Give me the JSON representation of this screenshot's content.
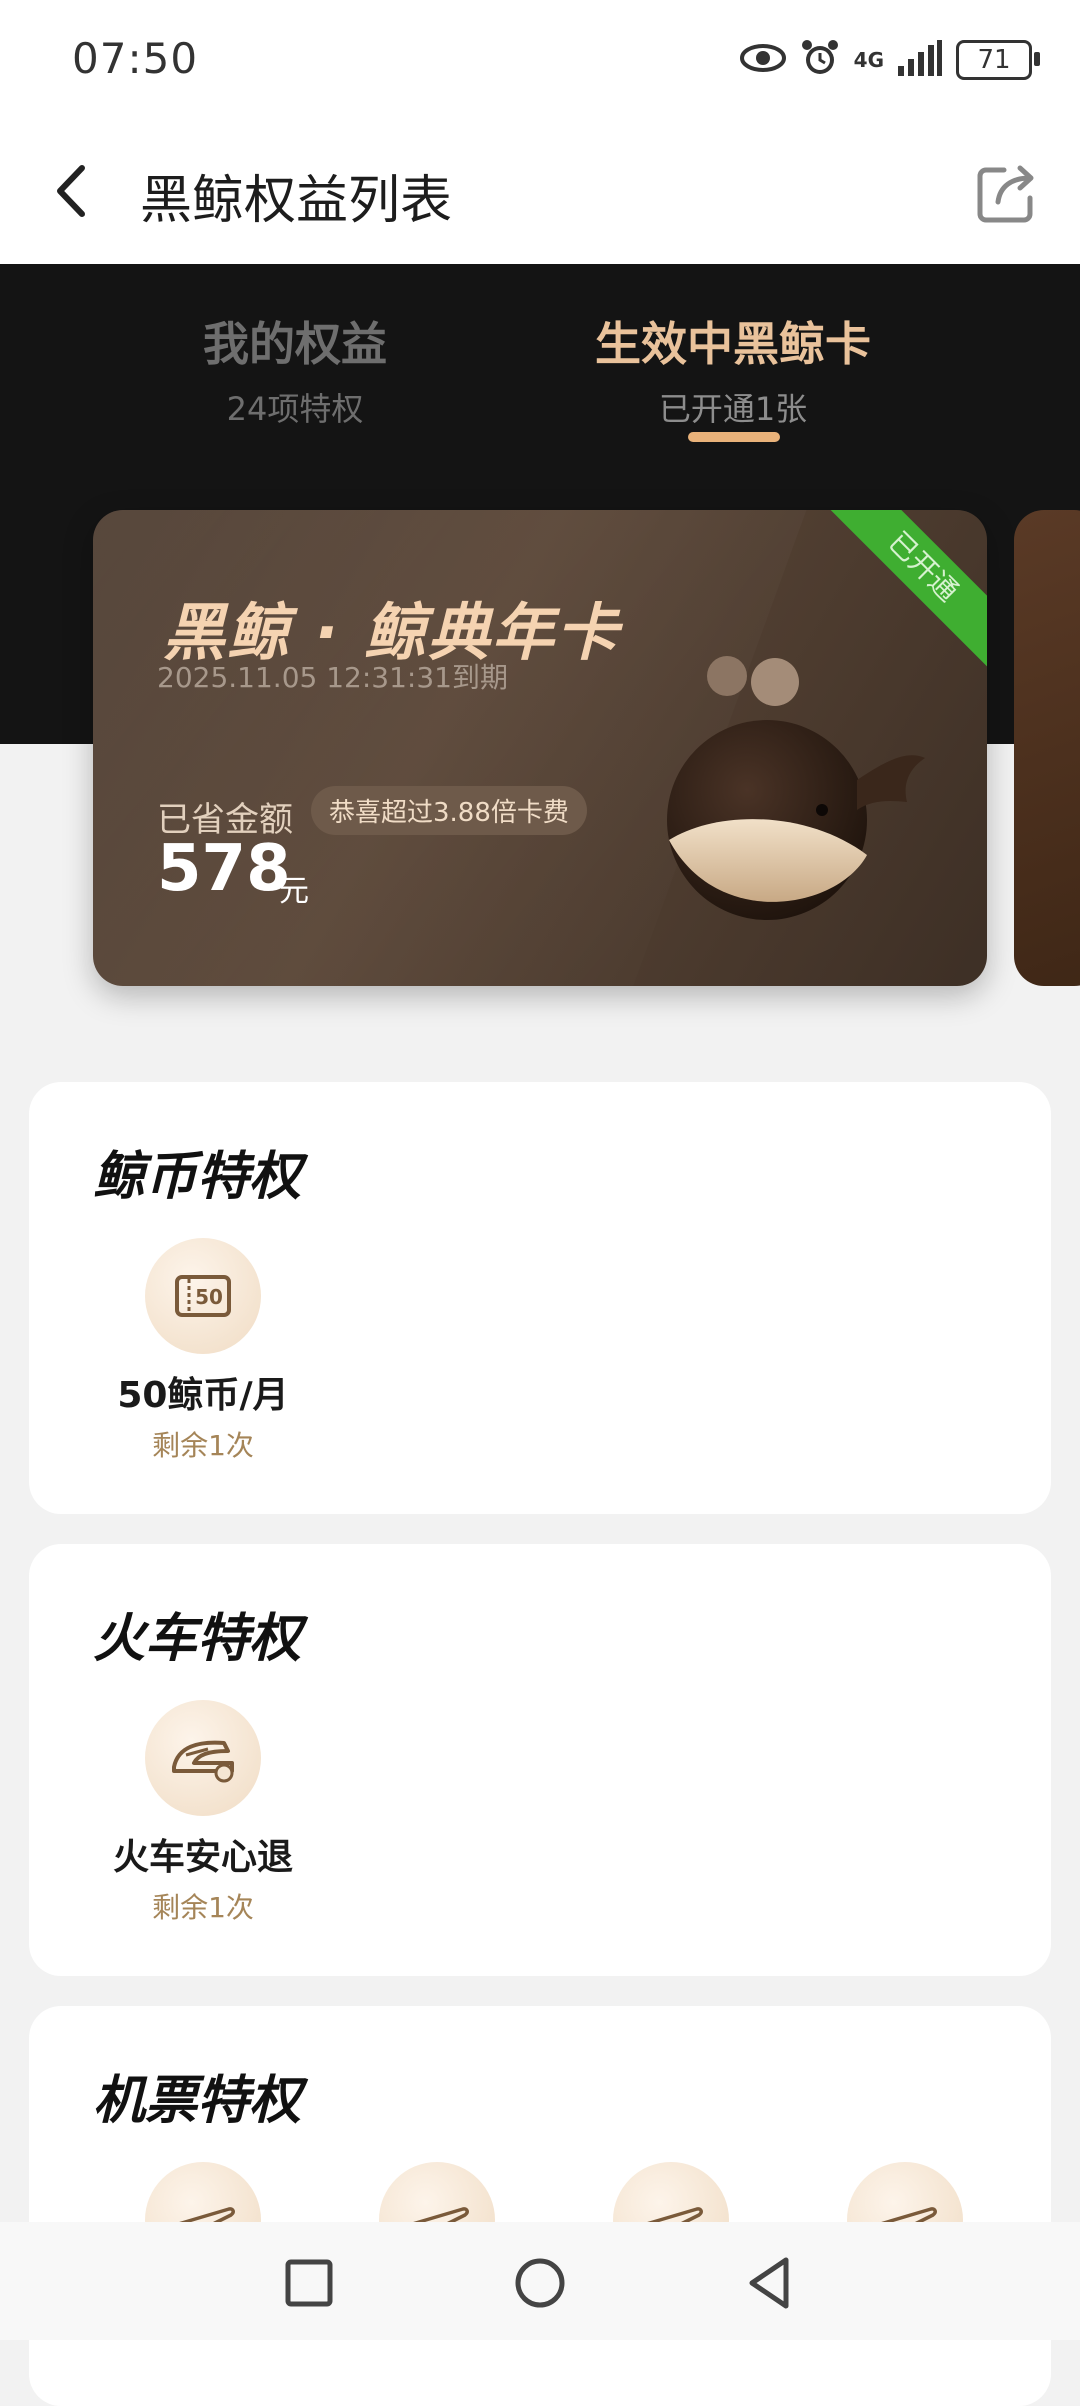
{
  "status_bar": {
    "time": "07:50",
    "network": "4G",
    "battery": "71"
  },
  "header": {
    "title": "黑鲸权益列表"
  },
  "tabs": [
    {
      "title": "我的权益",
      "subtitle": "24项特权"
    },
    {
      "title": "生效中黑鲸卡",
      "subtitle": "已开通1张"
    }
  ],
  "card": {
    "title": "黑鲸 · 鲸典年卡",
    "expiry": "2025.11.05 12:31:31到期",
    "saved_label": "已省金额",
    "badge": "恭喜超过3.88倍卡费",
    "amount": "578",
    "unit": "元",
    "ribbon": "已开通"
  },
  "sections": [
    {
      "title": "鲸币特权",
      "items": [
        {
          "name": "50鲸币/月",
          "remain": "剩余1次",
          "icon": "coin-ticket-icon"
        }
      ]
    },
    {
      "title": "火车特权",
      "items": [
        {
          "name": "火车安心退",
          "remain": "剩余1次",
          "icon": "train-icon"
        }
      ]
    },
    {
      "title": "机票特权",
      "items": [
        {
          "icon": "plane-icon"
        },
        {
          "icon": "plane-icon"
        },
        {
          "icon": "plane-icon"
        },
        {
          "icon": "plane-icon"
        }
      ]
    }
  ],
  "colors": {
    "accent": "#e9c29b",
    "ribbon": "#3fae31",
    "remain": "#a58558",
    "dark_bg": "#141414"
  }
}
